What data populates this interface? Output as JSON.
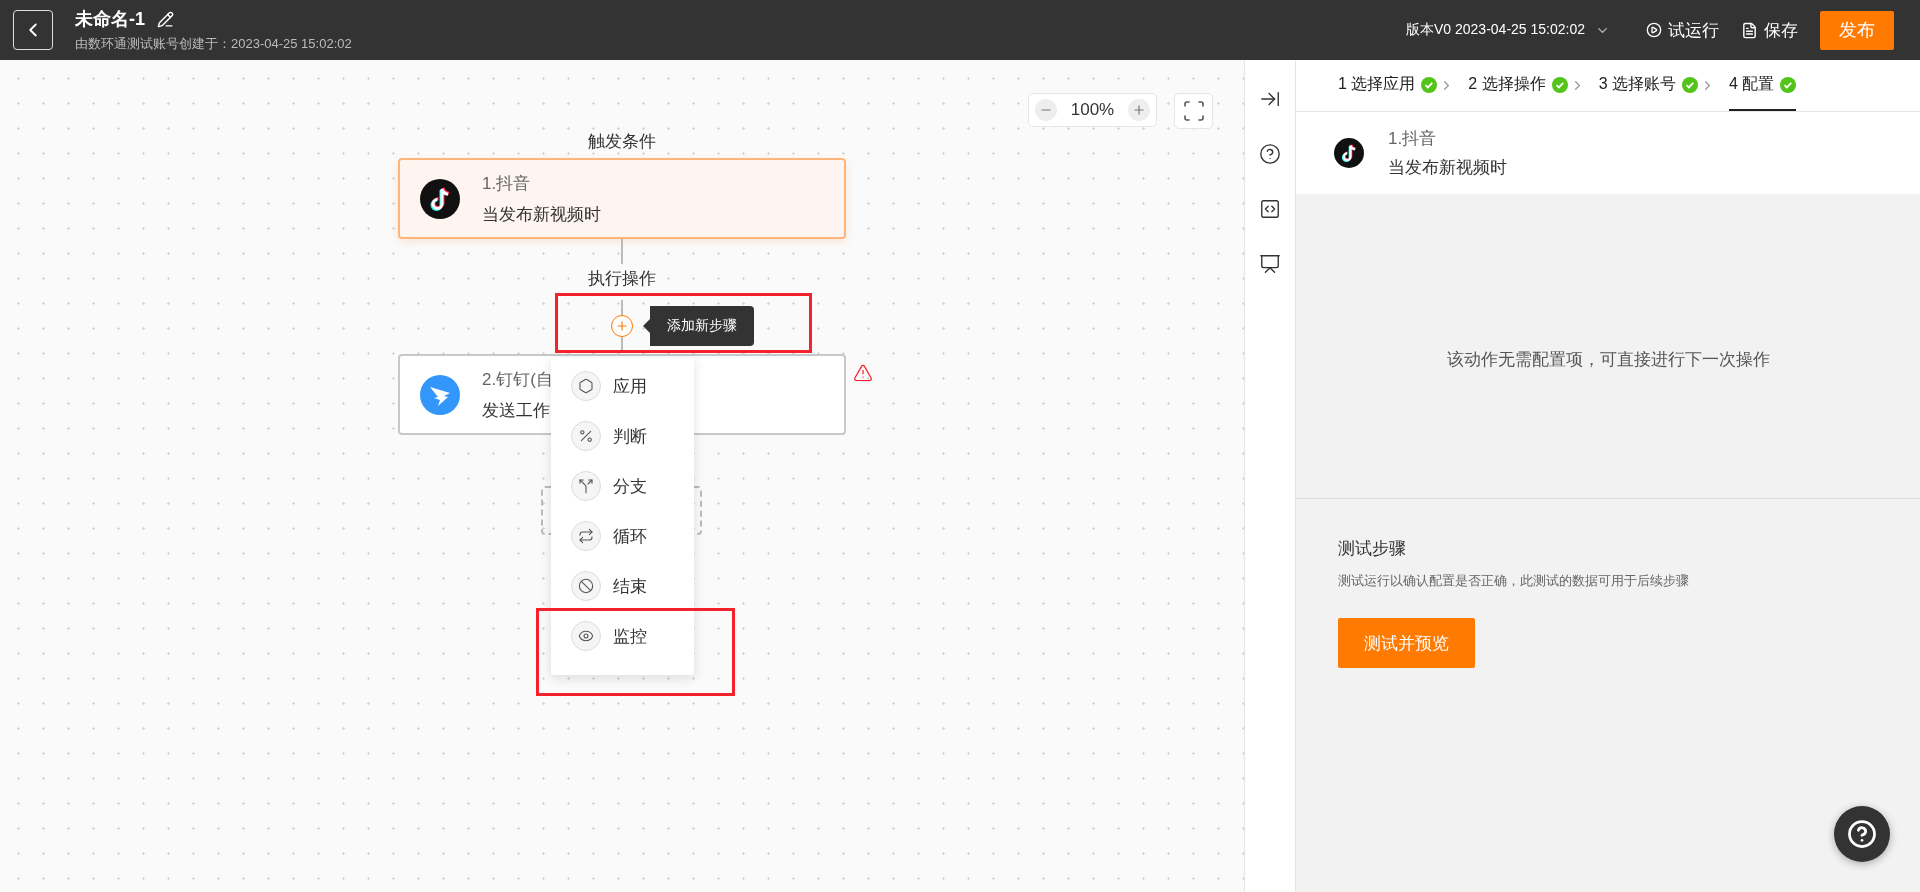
{
  "header": {
    "title": "未命名-1",
    "subtitle": "由数环通测试账号创建于：2023-04-25 15:02:02",
    "version": "版本V0 2023-04-25 15:02:02",
    "actions": [
      {
        "kind": "run",
        "label": "试运行"
      },
      {
        "kind": "save",
        "label": "保存"
      }
    ],
    "publish": "发布"
  },
  "canvas": {
    "zoom": "100%",
    "trigger_label": "触发条件",
    "action_label": "执行操作",
    "tooltip": "添加新步骤",
    "nodes": [
      {
        "kind": "douyin",
        "title": "1.抖音",
        "subtitle": "当发布新视频时",
        "selected": true,
        "warning": false
      },
      {
        "kind": "dingtalk",
        "title": "2.钉钉(自",
        "subtitle": "发送工作",
        "selected": false,
        "warning": true
      }
    ],
    "menu": [
      {
        "kind": "app",
        "label": "应用"
      },
      {
        "kind": "condition",
        "label": "判断"
      },
      {
        "kind": "branch",
        "label": "分支"
      },
      {
        "kind": "loop",
        "label": "循环"
      },
      {
        "kind": "end",
        "label": "结束"
      },
      {
        "kind": "monitor",
        "label": "监控"
      }
    ]
  },
  "panel": {
    "steps": [
      {
        "label": "1 选择应用",
        "done": true,
        "selected": false
      },
      {
        "label": "2 选择操作",
        "done": true,
        "selected": false
      },
      {
        "label": "3 选择账号",
        "done": true,
        "selected": false
      },
      {
        "label": "4 配置",
        "done": true,
        "selected": true
      }
    ],
    "trigger": {
      "kind": "douyin",
      "title": "1.抖音",
      "subtitle": "当发布新视频时"
    },
    "message": "该动作无需配置项，可直接进行下一次操作",
    "test": {
      "title": "测试步骤",
      "description": "测试运行以确认配置是否正确，此测试的数据可用于后续步骤",
      "button": "测试并预览"
    }
  }
}
